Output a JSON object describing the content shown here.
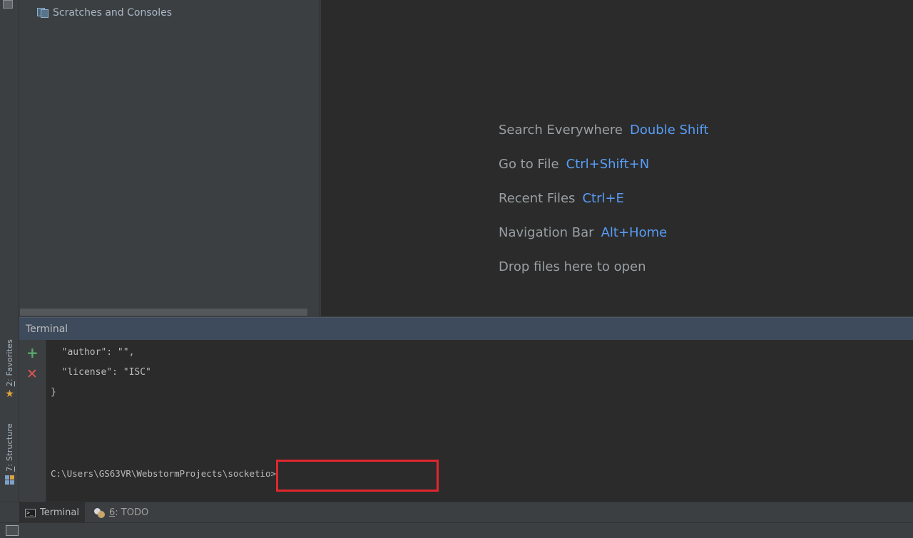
{
  "project": {
    "items": [
      {
        "label": "Scratches and Consoles",
        "icon": "scratches-icon"
      }
    ]
  },
  "editor": {
    "hints": [
      {
        "label": "Search Everywhere",
        "shortcut": "Double Shift"
      },
      {
        "label": "Go to File",
        "shortcut": "Ctrl+Shift+N"
      },
      {
        "label": "Recent Files",
        "shortcut": "Ctrl+E"
      },
      {
        "label": "Navigation Bar",
        "shortcut": "Alt+Home"
      },
      {
        "label": "Drop files here to open",
        "shortcut": ""
      }
    ]
  },
  "left_strip": {
    "favorites": {
      "number": "2",
      "label": ": Favorites",
      "icon": "star-icon"
    },
    "structure": {
      "number": "7",
      "label": ": Structure",
      "icon": "structure-icon"
    }
  },
  "terminal": {
    "title": "Terminal",
    "lines": [
      "  \"author\": \"\",",
      "  \"license\": \"ISC\"",
      "}"
    ],
    "prompt": "C:\\Users\\GS63VR\\WebstormProjects\\socketio>"
  },
  "bottom_tabs": {
    "terminal": {
      "label": "Terminal",
      "icon": "terminal-icon"
    },
    "todo": {
      "number": "6",
      "label": ": TODO",
      "icon": "todo-icon"
    }
  },
  "colors": {
    "shortcut": "#589df6",
    "highlight_box": "#e0262e",
    "add_button": "#59a869",
    "close_button": "#e05555"
  }
}
